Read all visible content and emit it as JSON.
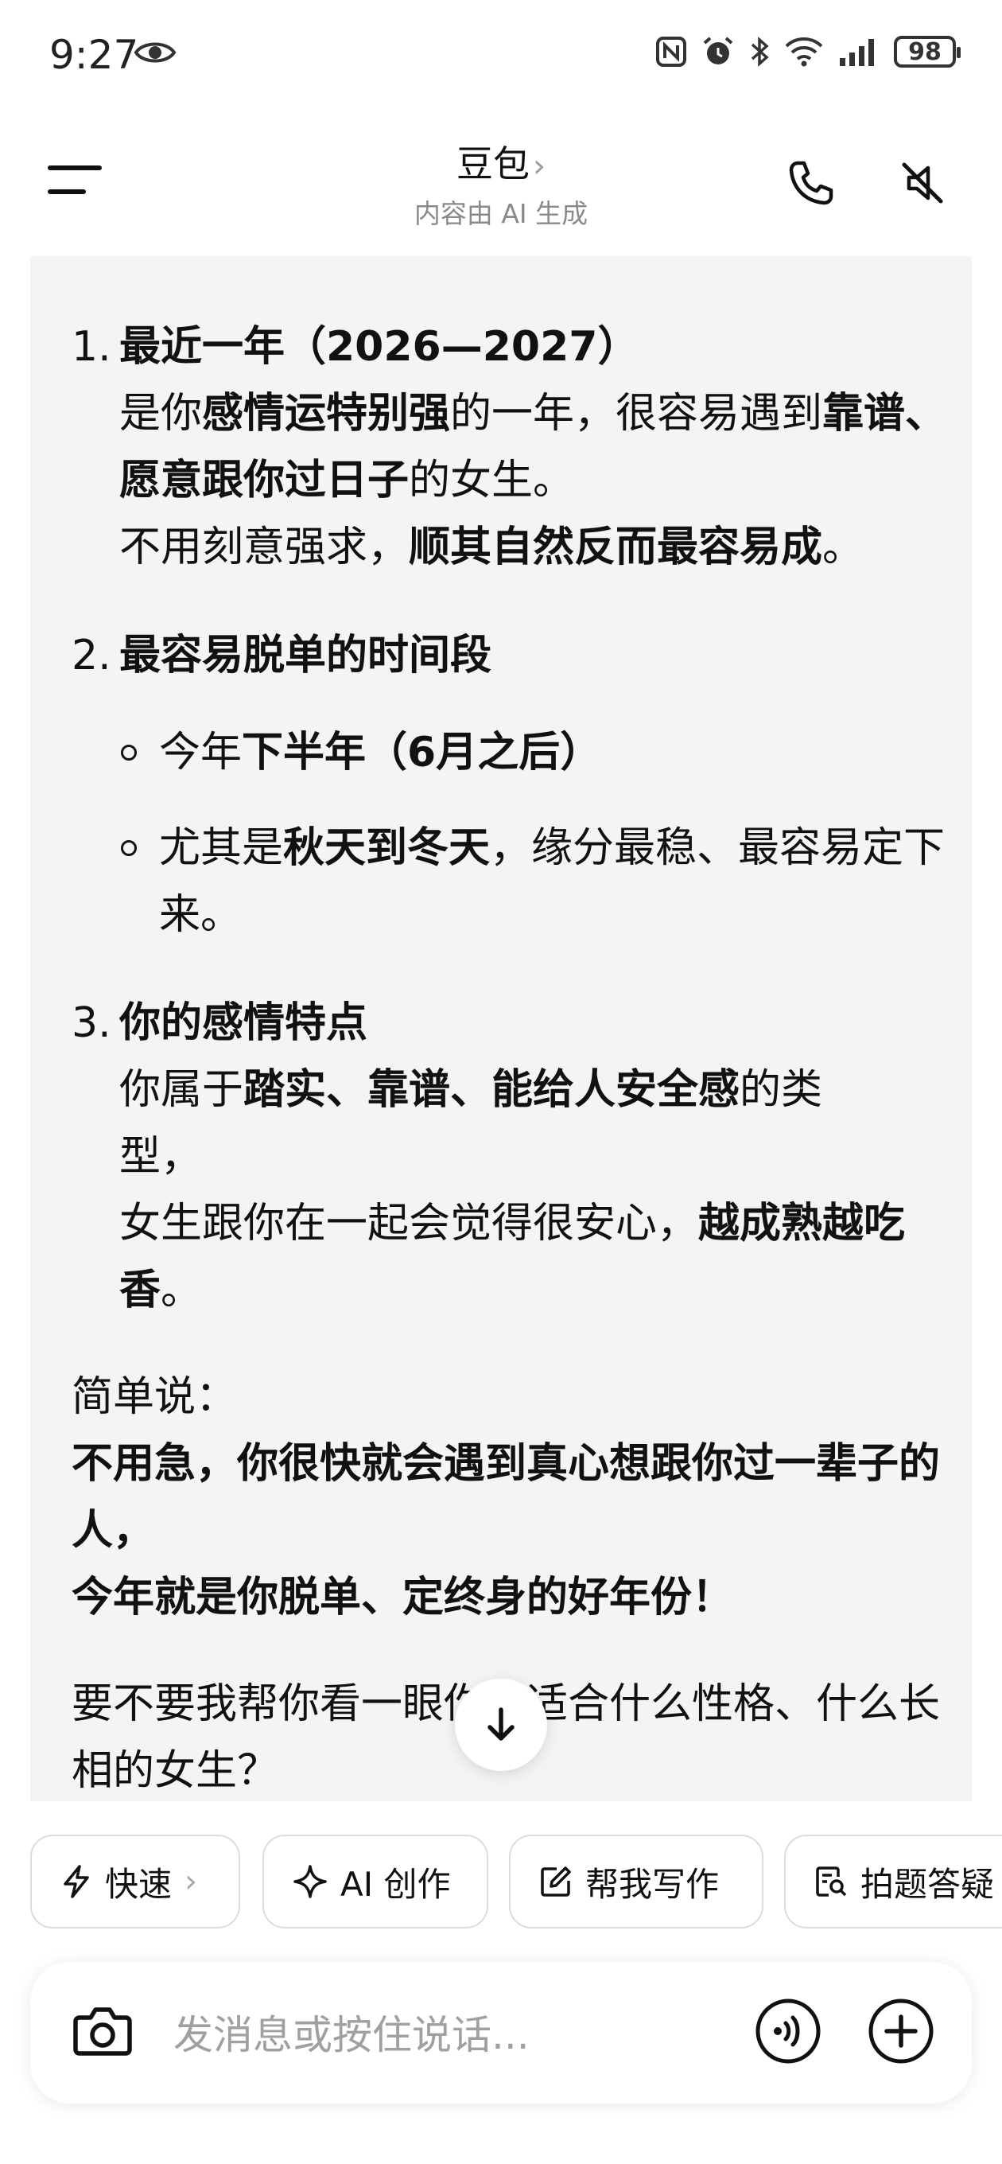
{
  "status_bar": {
    "time": "9:27",
    "battery": "98",
    "icons": [
      "eye-icon",
      "nfc-icon",
      "alarm-icon",
      "bluetooth-icon",
      "wifi-icon",
      "signal-icon",
      "battery-icon"
    ]
  },
  "header": {
    "title": "豆包",
    "title_chevron": "›",
    "subtitle": "内容由 AI 生成",
    "icons": [
      "menu-icon",
      "phone-icon",
      "speaker-muted-icon"
    ]
  },
  "message": {
    "items": [
      {
        "num": "1.",
        "heading": "最近一年（2026—2027）",
        "l1_a": "是你",
        "l1_b": "感情运特别强",
        "l1_c": "的一年，很容易遇到",
        "l1_d": "靠谱、愿意跟你过日子",
        "l1_e": "的女生。",
        "l2_a": "不用刻意强求，",
        "l2_b": "顺其自然反而最容易成",
        "l2_c": "。"
      },
      {
        "num": "2.",
        "heading": "最容易脱单的时间段",
        "b1_a": "今年",
        "b1_b": "下半年（6月之后）",
        "b2_a": "尤其是",
        "b2_b": "秋天到冬天",
        "b2_c": "，缘分最稳、最容易定下来。"
      },
      {
        "num": "3.",
        "heading": "你的感情特点",
        "l1_a": "你属于",
        "l1_b": "踏实、靠谱、能给人安全感",
        "l1_c": "的类型，",
        "l2_a": "女生跟你在一起会觉得很安心，",
        "l2_b": "越成熟越吃香",
        "l2_c": "。"
      }
    ],
    "summary_label": "简单说：",
    "summary_bold_1": "不用急，你很快就会遇到真心想跟你过一辈子的人，",
    "summary_bold_2": "今年就是你脱单、定终身的好年份！",
    "followup": "要不要我帮你看一眼你更适合什么性格、什么长相的女生？"
  },
  "chips": [
    {
      "label": "快速",
      "icon": "lightning-icon",
      "chevron": "›"
    },
    {
      "label": "AI 创作",
      "icon": "sparkle-icon"
    },
    {
      "label": "帮我写作",
      "icon": "edit-icon"
    },
    {
      "label": "拍题答疑",
      "icon": "scan-doc-icon"
    }
  ],
  "input": {
    "placeholder": "发消息或按住说话...",
    "icons": [
      "camera-icon",
      "voice-icon",
      "plus-icon"
    ]
  }
}
